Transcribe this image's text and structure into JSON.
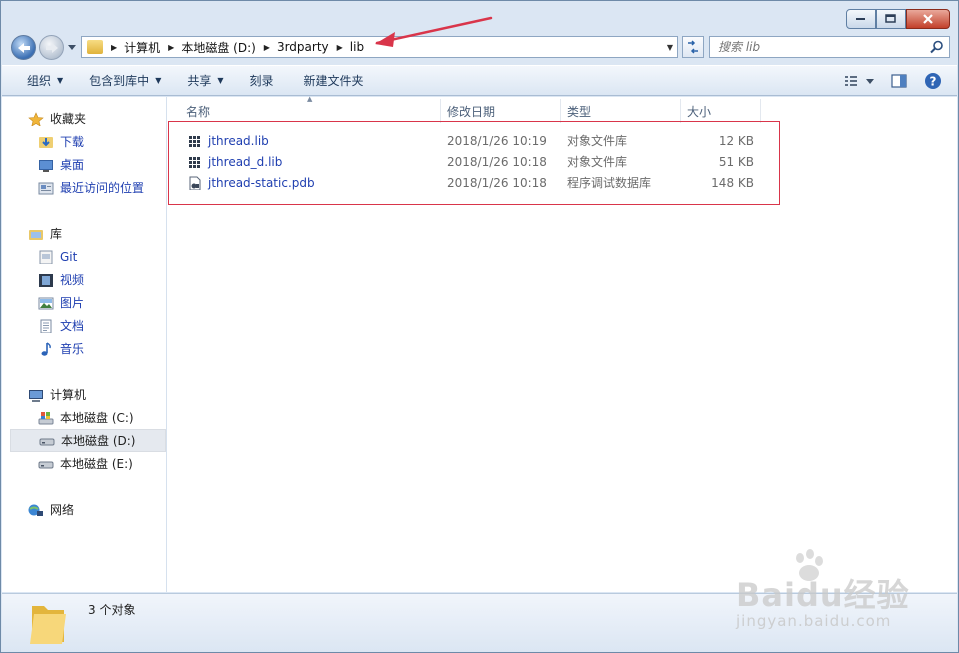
{
  "window": {
    "caption_buttons": [
      "minimize",
      "maximize",
      "close"
    ]
  },
  "address_bar": {
    "crumbs": [
      "计算机",
      "本地磁盘 (D:)",
      "3rdparty",
      "lib"
    ]
  },
  "search": {
    "placeholder": "搜索 lib"
  },
  "toolbar": {
    "organize": "组织",
    "include_in_library": "包含到库中",
    "share": "共享",
    "burn": "刻录",
    "new_folder": "新建文件夹"
  },
  "sidebar": {
    "favorites": {
      "label": "收藏夹",
      "items": [
        {
          "label": "下载",
          "icon": "download-folder-icon"
        },
        {
          "label": "桌面",
          "icon": "desktop-icon"
        },
        {
          "label": "最近访问的位置",
          "icon": "recent-places-icon"
        }
      ]
    },
    "libraries": {
      "label": "库",
      "items": [
        {
          "label": "Git",
          "icon": "git-library-icon"
        },
        {
          "label": "视频",
          "icon": "video-library-icon"
        },
        {
          "label": "图片",
          "icon": "pictures-library-icon"
        },
        {
          "label": "文档",
          "icon": "documents-library-icon"
        },
        {
          "label": "音乐",
          "icon": "music-library-icon"
        }
      ]
    },
    "computer": {
      "label": "计算机",
      "items": [
        {
          "label": "本地磁盘 (C:)",
          "icon": "system-drive-icon"
        },
        {
          "label": "本地磁盘 (D:)",
          "icon": "drive-icon",
          "selected": true
        },
        {
          "label": "本地磁盘 (E:)",
          "icon": "drive-icon"
        }
      ]
    },
    "network": {
      "label": "网络"
    }
  },
  "columns": {
    "name": "名称",
    "date": "修改日期",
    "type": "类型",
    "size": "大小"
  },
  "files": [
    {
      "name": "jthread.lib",
      "date": "2018/1/26 10:19",
      "type": "对象文件库",
      "size": "12 KB",
      "icon": "library-file-icon"
    },
    {
      "name": "jthread_d.lib",
      "date": "2018/1/26 10:18",
      "type": "对象文件库",
      "size": "51 KB",
      "icon": "library-file-icon"
    },
    {
      "name": "jthread-static.pdb",
      "date": "2018/1/26 10:18",
      "type": "程序调试数据库",
      "size": "148 KB",
      "icon": "pdb-file-icon"
    }
  ],
  "details": {
    "count": "3 个对象"
  },
  "watermark": {
    "main": "Baidu经验",
    "sub": "jingyan.baidu.com"
  },
  "colors": {
    "annotation": "#d9354a",
    "link_text": "#1f3fb0",
    "toolbar_text": "#1e395b"
  }
}
